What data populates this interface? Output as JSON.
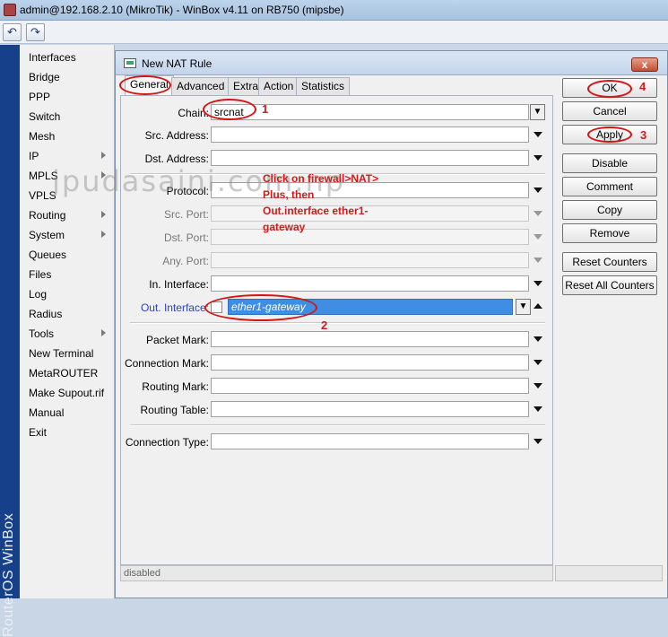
{
  "window": {
    "title": "admin@192.168.2.10 (MikroTik) - WinBox v4.11 on RB750 (mipsbe)"
  },
  "toolbar": {
    "undo_icon": "undo-icon",
    "redo_icon": "redo-icon"
  },
  "branding": {
    "text": "RouterOS WinBox"
  },
  "sidebar": {
    "items": [
      {
        "label": "Interfaces",
        "submenu": false
      },
      {
        "label": "Bridge",
        "submenu": false
      },
      {
        "label": "PPP",
        "submenu": false
      },
      {
        "label": "Switch",
        "submenu": false
      },
      {
        "label": "Mesh",
        "submenu": false
      },
      {
        "label": "IP",
        "submenu": true
      },
      {
        "label": "MPLS",
        "submenu": true
      },
      {
        "label": "VPLS",
        "submenu": false
      },
      {
        "label": "Routing",
        "submenu": true
      },
      {
        "label": "System",
        "submenu": true
      },
      {
        "label": "Queues",
        "submenu": false
      },
      {
        "label": "Files",
        "submenu": false
      },
      {
        "label": "Log",
        "submenu": false
      },
      {
        "label": "Radius",
        "submenu": false
      },
      {
        "label": "Tools",
        "submenu": true
      },
      {
        "label": "New Terminal",
        "submenu": false
      },
      {
        "label": "MetaROUTER",
        "submenu": false
      },
      {
        "label": "Make Supout.rif",
        "submenu": false
      },
      {
        "label": "Manual",
        "submenu": false
      },
      {
        "label": "Exit",
        "submenu": false
      }
    ]
  },
  "dialog": {
    "title": "New NAT Rule",
    "close_label": "x",
    "tabs": [
      "General",
      "Advanced",
      "Extra",
      "Action",
      "Statistics"
    ],
    "active_tab": "General",
    "fields": {
      "chain": {
        "label": "Chain:",
        "value": "srcnat"
      },
      "src_address": {
        "label": "Src. Address:"
      },
      "dst_address": {
        "label": "Dst. Address:"
      },
      "protocol": {
        "label": "Protocol:"
      },
      "src_port": {
        "label": "Src. Port:"
      },
      "dst_port": {
        "label": "Dst. Port:"
      },
      "any_port": {
        "label": "Any. Port:"
      },
      "in_interface": {
        "label": "In. Interface:"
      },
      "out_interface": {
        "label": "Out. Interface:",
        "value": "ether1-gateway"
      },
      "packet_mark": {
        "label": "Packet Mark:"
      },
      "connection_mark": {
        "label": "Connection Mark:"
      },
      "routing_mark": {
        "label": "Routing Mark:"
      },
      "routing_table": {
        "label": "Routing Table:"
      },
      "connection_type": {
        "label": "Connection Type:"
      }
    },
    "buttons": {
      "ok": "OK",
      "cancel": "Cancel",
      "apply": "Apply",
      "disable": "Disable",
      "comment": "Comment",
      "copy": "Copy",
      "remove": "Remove",
      "reset_counters": "Reset Counters",
      "reset_all_counters": "Reset All Counters"
    },
    "status": "disabled"
  },
  "annotations": {
    "note_lines": [
      "Click on firewall>NAT>",
      "Plus, then",
      "Out.interface ether1-",
      "gateway"
    ],
    "step1": "1",
    "step2": "2",
    "step3": "3",
    "step4": "4",
    "color": "#d21a1a"
  },
  "watermark": "jpudasaini.com.np"
}
